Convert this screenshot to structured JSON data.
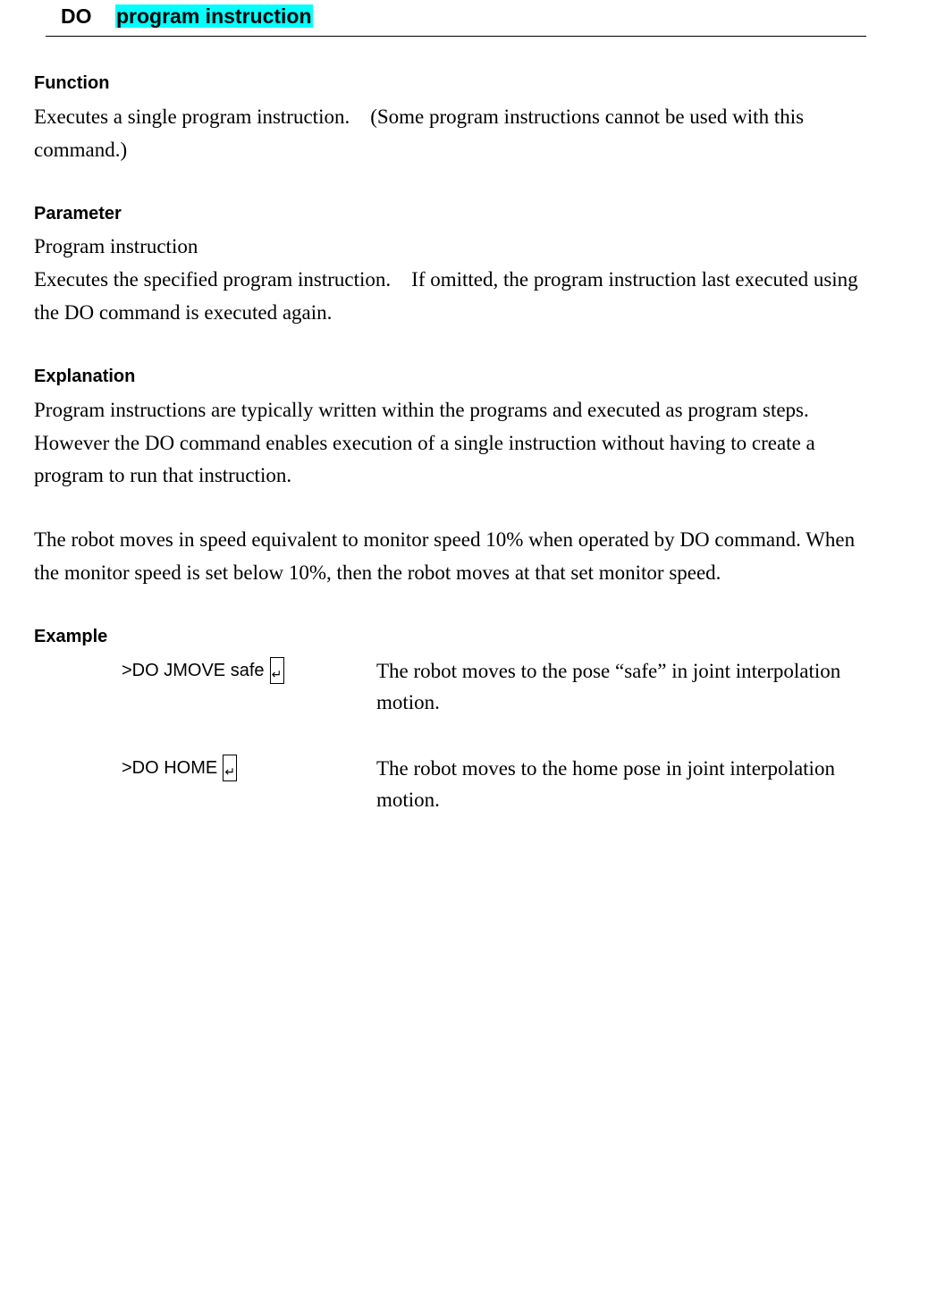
{
  "header": {
    "keyword": "DO",
    "parameter": "program instruction"
  },
  "function": {
    "heading": "Function",
    "text": "Executes a single program instruction.    (Some program instructions cannot be used with this command.)"
  },
  "parameter": {
    "heading": "Parameter",
    "name": "Program instruction",
    "text": "Executes the specified program instruction.    If omitted, the program instruction last executed using the DO command is executed again."
  },
  "explanation": {
    "heading": "Explanation",
    "paragraph1": "Program instructions are typically written within the programs and executed as program steps. However the DO command enables execution of a single instruction without having to create a program to run that instruction.",
    "paragraph2": "The robot moves in speed equivalent to monitor speed 10% when operated by DO command. When the monitor speed is set below 10%, then the robot moves at that set monitor speed."
  },
  "example": {
    "heading": "Example",
    "enter_symbol": "↵",
    "items": [
      {
        "command": ">DO JMOVE safe",
        "description": "The robot moves to the pose “safe” in joint interpolation motion."
      },
      {
        "command": ">DO HOME",
        "description": "The robot moves to the home pose in joint interpolation motion."
      }
    ]
  }
}
